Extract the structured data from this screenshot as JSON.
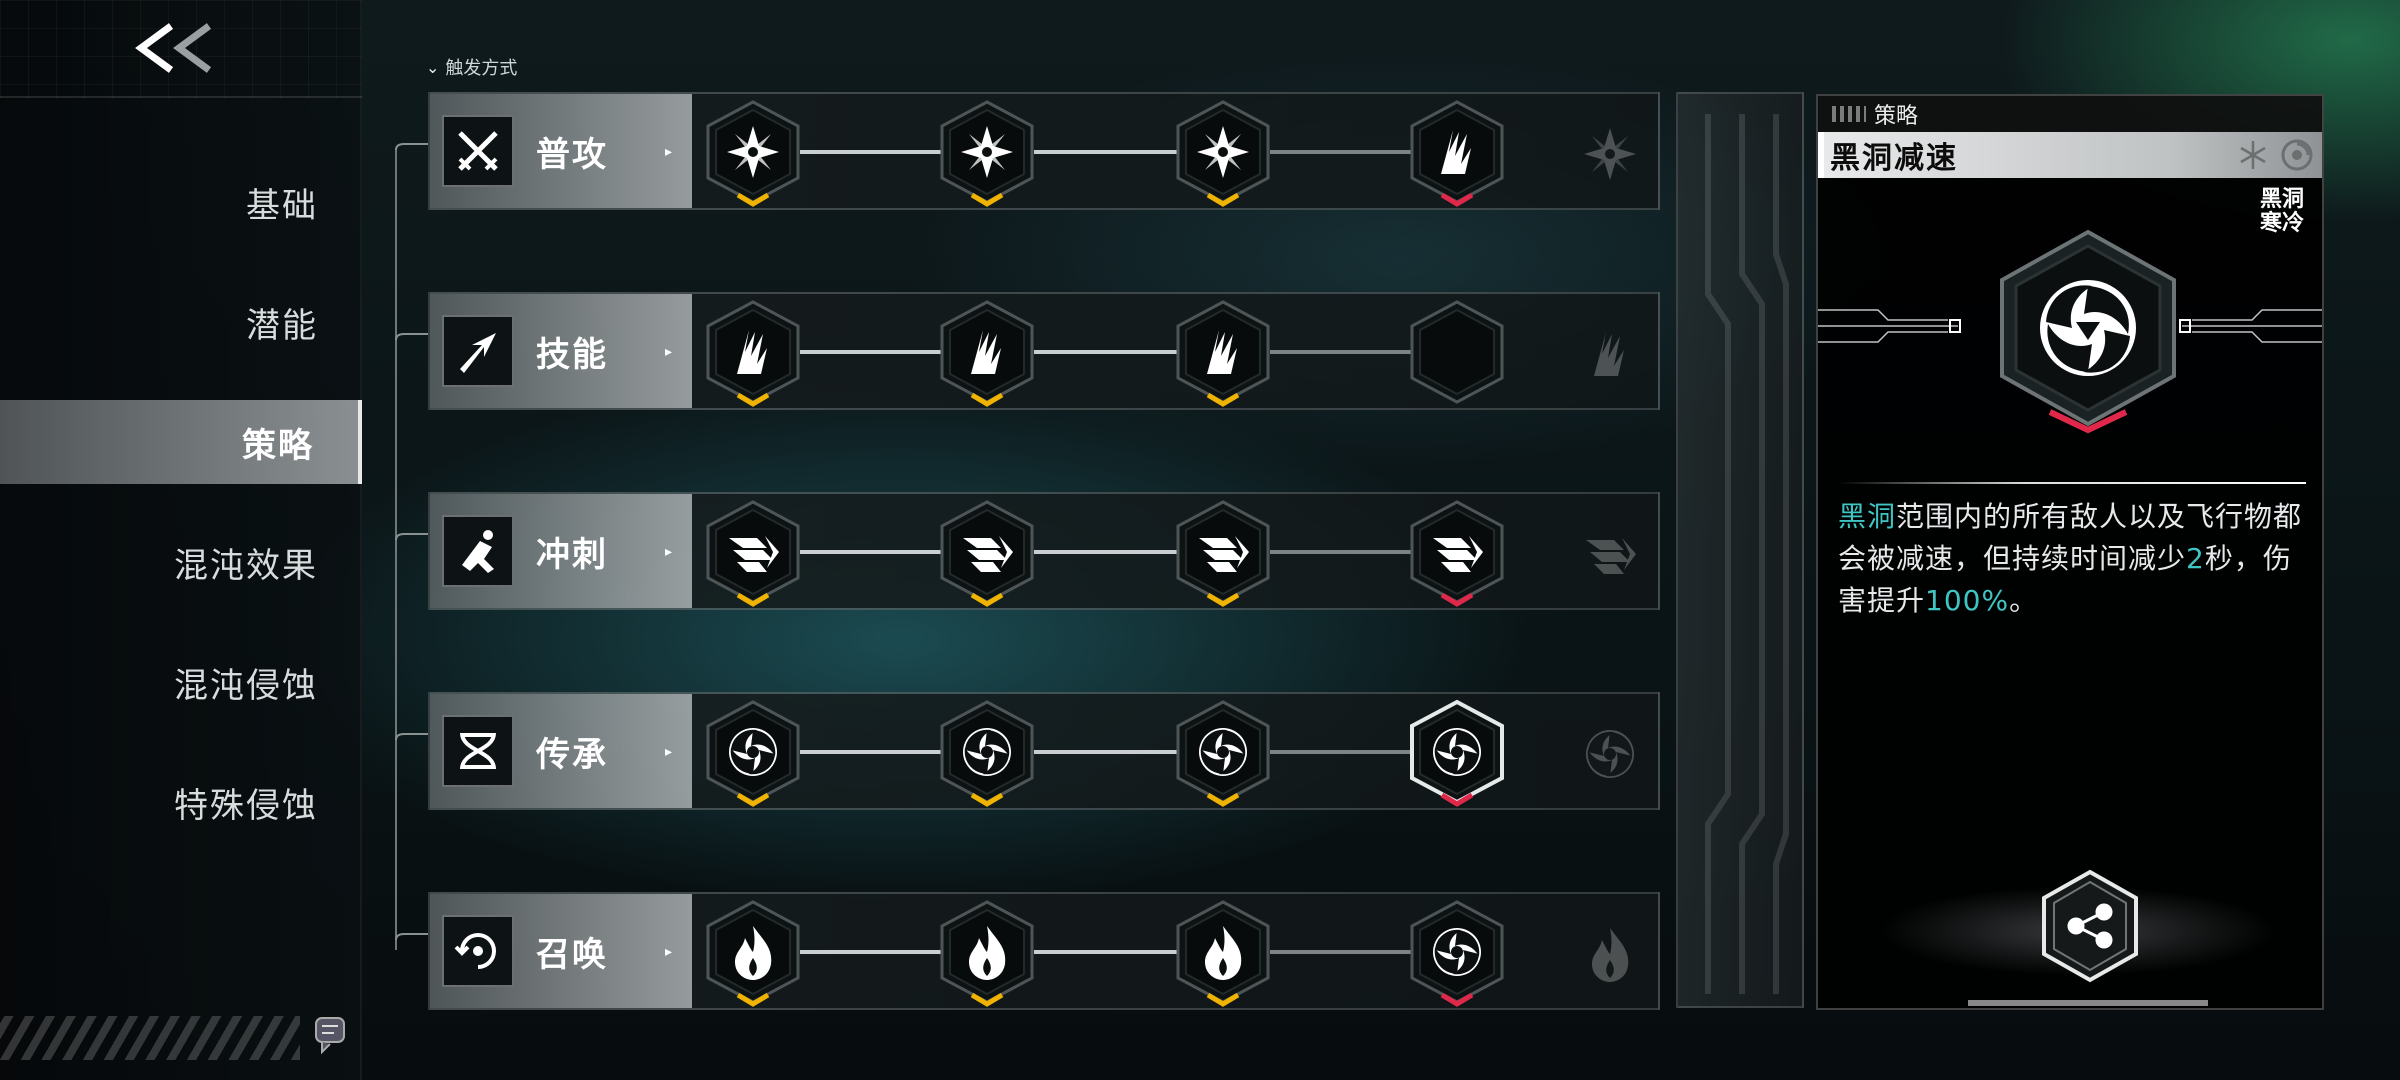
{
  "sidebar": {
    "items": [
      {
        "label": "基础",
        "active": false
      },
      {
        "label": "潜能",
        "active": false
      },
      {
        "label": "策略",
        "active": true
      },
      {
        "label": "混沌效果",
        "active": false
      },
      {
        "label": "混沌侵蚀",
        "active": false
      },
      {
        "label": "特殊侵蚀",
        "active": false
      }
    ]
  },
  "header": {
    "trigger_label": "触发方式"
  },
  "rows": [
    {
      "label": "普攻",
      "icon": "crossed-swords-icon",
      "nodes": [
        "shuriken-icon",
        "shuriken-icon",
        "shuriken-icon",
        "claw-slash-icon"
      ],
      "ticks": [
        "yellow",
        "yellow",
        "yellow",
        "red"
      ]
    },
    {
      "label": "技能",
      "icon": "slash-arrow-icon",
      "nodes": [
        "claw-slash-icon",
        "claw-slash-icon",
        "claw-slash-icon",
        "empty"
      ],
      "ticks": [
        "yellow",
        "yellow",
        "yellow",
        "none"
      ]
    },
    {
      "label": "冲刺",
      "icon": "dash-icon",
      "nodes": [
        "wing-dash-icon",
        "wing-dash-icon",
        "wing-dash-icon",
        "wing-dash-icon"
      ],
      "ticks": [
        "yellow",
        "yellow",
        "yellow",
        "red"
      ]
    },
    {
      "label": "传承",
      "icon": "dna-icon",
      "nodes": [
        "vortex-icon",
        "vortex-icon",
        "vortex-icon",
        "vortex-icon"
      ],
      "ticks": [
        "yellow",
        "yellow",
        "yellow",
        "red"
      ]
    },
    {
      "label": "召唤",
      "icon": "summon-icon",
      "nodes": [
        "flame-icon",
        "flame-icon",
        "flame-icon",
        "vortex-icon"
      ],
      "ticks": [
        "yellow",
        "yellow",
        "yellow",
        "red"
      ]
    }
  ],
  "detail": {
    "tag": "策略",
    "title": "黑洞减速",
    "element_tags": [
      "黑洞",
      "寒冷"
    ],
    "desc_parts": [
      {
        "text": "黑洞",
        "hl": true
      },
      {
        "text": "范围内的所有敌人以及飞行物都会被减速，但持续时间减少",
        "hl": false
      },
      {
        "text": "2",
        "hl": true
      },
      {
        "text": "秒，伤害提升",
        "hl": false
      },
      {
        "text": "100%",
        "hl": true
      },
      {
        "text": "。",
        "hl": false
      }
    ]
  },
  "colors": {
    "accent_teal": "#3fc6c4",
    "tick_yellow": "#f0b400",
    "tick_red": "#e0284a"
  }
}
